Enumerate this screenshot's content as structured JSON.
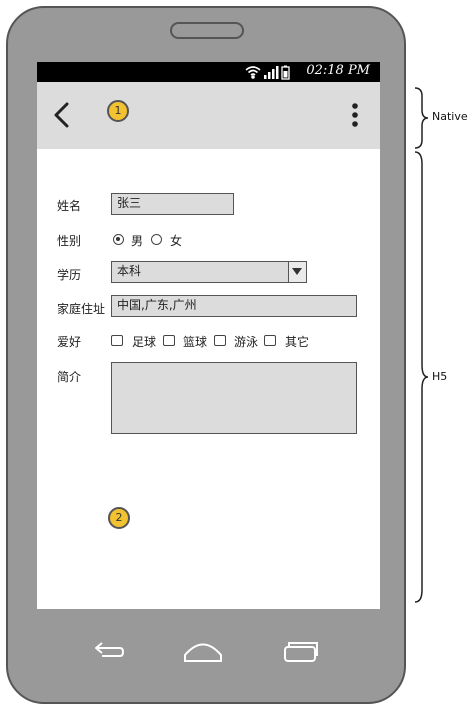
{
  "statusbar": {
    "time": "02:18 PM",
    "icons": [
      "wifi-icon",
      "signal-icon",
      "battery-icon"
    ]
  },
  "appbar": {
    "back_icon": "chevron-left-icon",
    "menu_icon": "more-vertical-icon",
    "badge": "1"
  },
  "form": {
    "name": {
      "label": "姓名",
      "value": "张三"
    },
    "gender": {
      "label": "性别",
      "options": [
        {
          "label": "男",
          "selected": true
        },
        {
          "label": "女",
          "selected": false
        }
      ]
    },
    "education": {
      "label": "学历",
      "value": "本科"
    },
    "address": {
      "label": "家庭住址",
      "value": "中国,广东,广州"
    },
    "hobbies": {
      "label": "爱好",
      "options": [
        {
          "label": "足球",
          "checked": false
        },
        {
          "label": "篮球",
          "checked": false
        },
        {
          "label": "游泳",
          "checked": false
        },
        {
          "label": "其它",
          "checked": false
        }
      ]
    },
    "intro": {
      "label": "简介",
      "value": ""
    }
  },
  "content_badge": "2",
  "annotations": {
    "native": "Native",
    "h5": "H5"
  },
  "colors": {
    "phone_body": "#999999",
    "bar_gray": "#dcdcdc",
    "badge_yellow": "#f2c230"
  }
}
